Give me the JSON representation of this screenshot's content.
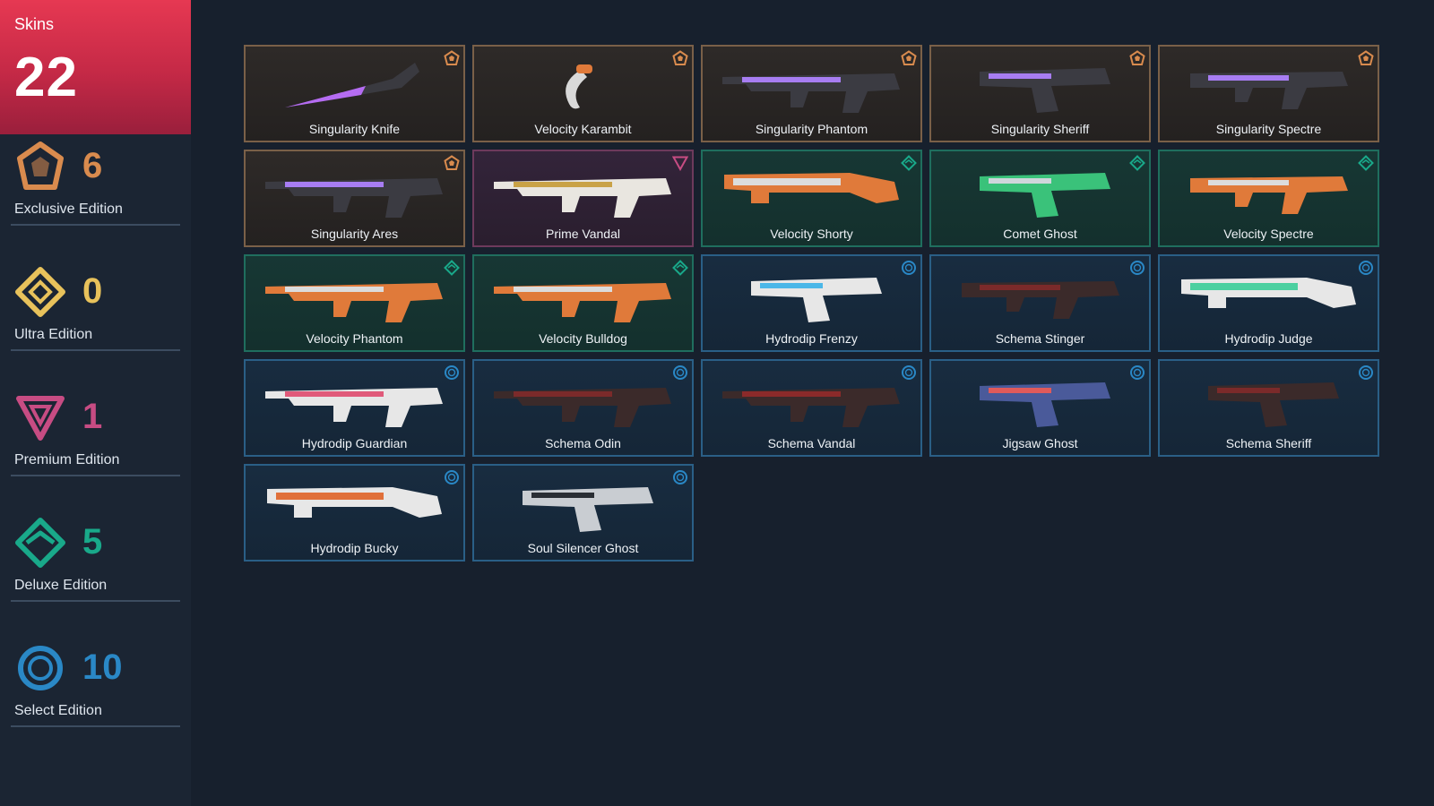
{
  "sidebar": {
    "skins_label": "Skins",
    "skins_count": "22",
    "tiers": [
      {
        "id": "exclusive",
        "label": "Exclusive Edition",
        "count": "6",
        "color": "#d98b4e"
      },
      {
        "id": "ultra",
        "label": "Ultra Edition",
        "count": "0",
        "color": "#e8c25b"
      },
      {
        "id": "premium",
        "label": "Premium Edition",
        "count": "1",
        "color": "#c74c83"
      },
      {
        "id": "deluxe",
        "label": "Deluxe Edition",
        "count": "5",
        "color": "#19a98a"
      },
      {
        "id": "select",
        "label": "Select Edition",
        "count": "10",
        "color": "#2a88c6"
      }
    ]
  },
  "skins": [
    {
      "name": "Singularity Knife",
      "tier": "exclusive",
      "kind": "knife",
      "palette": [
        "#3a3a40",
        "#b56cf2"
      ]
    },
    {
      "name": "Velocity Karambit",
      "tier": "exclusive",
      "kind": "karambit",
      "palette": [
        "#d9d9d9",
        "#e07a3a"
      ]
    },
    {
      "name": "Singularity Phantom",
      "tier": "exclusive",
      "kind": "rifle",
      "palette": [
        "#3b3b42",
        "#a77df2"
      ]
    },
    {
      "name": "Singularity Sheriff",
      "tier": "exclusive",
      "kind": "pistol",
      "palette": [
        "#3b3b42",
        "#a77df2"
      ]
    },
    {
      "name": "Singularity Spectre",
      "tier": "exclusive",
      "kind": "smg",
      "palette": [
        "#3b3b42",
        "#a77df2"
      ]
    },
    {
      "name": "Singularity Ares",
      "tier": "exclusive",
      "kind": "rifle",
      "palette": [
        "#3b3b42",
        "#a77df2"
      ]
    },
    {
      "name": "Prime Vandal",
      "tier": "premium",
      "kind": "rifle",
      "palette": [
        "#e9e6e0",
        "#c9a247"
      ]
    },
    {
      "name": "Velocity Shorty",
      "tier": "deluxe",
      "kind": "shotgun",
      "palette": [
        "#e07a3a",
        "#dcdcdc"
      ]
    },
    {
      "name": "Comet Ghost",
      "tier": "deluxe",
      "kind": "pistol",
      "palette": [
        "#3ac27a",
        "#cfd6dc"
      ]
    },
    {
      "name": "Velocity Spectre",
      "tier": "deluxe",
      "kind": "smg",
      "palette": [
        "#e07a3a",
        "#dcdcdc"
      ]
    },
    {
      "name": "Velocity Phantom",
      "tier": "deluxe",
      "kind": "rifle",
      "palette": [
        "#e07a3a",
        "#dcdcdc"
      ]
    },
    {
      "name": "Velocity Bulldog",
      "tier": "deluxe",
      "kind": "rifle",
      "palette": [
        "#e07a3a",
        "#dcdcdc"
      ]
    },
    {
      "name": "Hydrodip Frenzy",
      "tier": "select",
      "kind": "pistol",
      "palette": [
        "#e7e7e7",
        "#4bb7e8"
      ]
    },
    {
      "name": "Schema Stinger",
      "tier": "select",
      "kind": "smg",
      "palette": [
        "#3b2a2a",
        "#7b2a2a"
      ]
    },
    {
      "name": "Hydrodip Judge",
      "tier": "select",
      "kind": "shotgun",
      "palette": [
        "#e7e7e7",
        "#4bd0a0"
      ]
    },
    {
      "name": "Hydrodip Guardian",
      "tier": "select",
      "kind": "rifle",
      "palette": [
        "#e7e7e7",
        "#e05a7a"
      ]
    },
    {
      "name": "Schema Odin",
      "tier": "select",
      "kind": "rifle",
      "palette": [
        "#3b2a2a",
        "#7b2a2a"
      ]
    },
    {
      "name": "Schema Vandal",
      "tier": "select",
      "kind": "rifle",
      "palette": [
        "#3b2a2a",
        "#8b2a2a"
      ]
    },
    {
      "name": "Jigsaw Ghost",
      "tier": "select",
      "kind": "pistol",
      "palette": [
        "#4a5a9a",
        "#e05a5a"
      ]
    },
    {
      "name": "Schema Sheriff",
      "tier": "select",
      "kind": "pistol",
      "palette": [
        "#3b2a2a",
        "#7b2a2a"
      ]
    },
    {
      "name": "Hydrodip Bucky",
      "tier": "select",
      "kind": "shotgun",
      "palette": [
        "#e7e7e7",
        "#e0703a"
      ]
    },
    {
      "name": "Soul Silencer Ghost",
      "tier": "select",
      "kind": "pistol",
      "palette": [
        "#c9cdd2",
        "#2a2e34"
      ]
    }
  ]
}
